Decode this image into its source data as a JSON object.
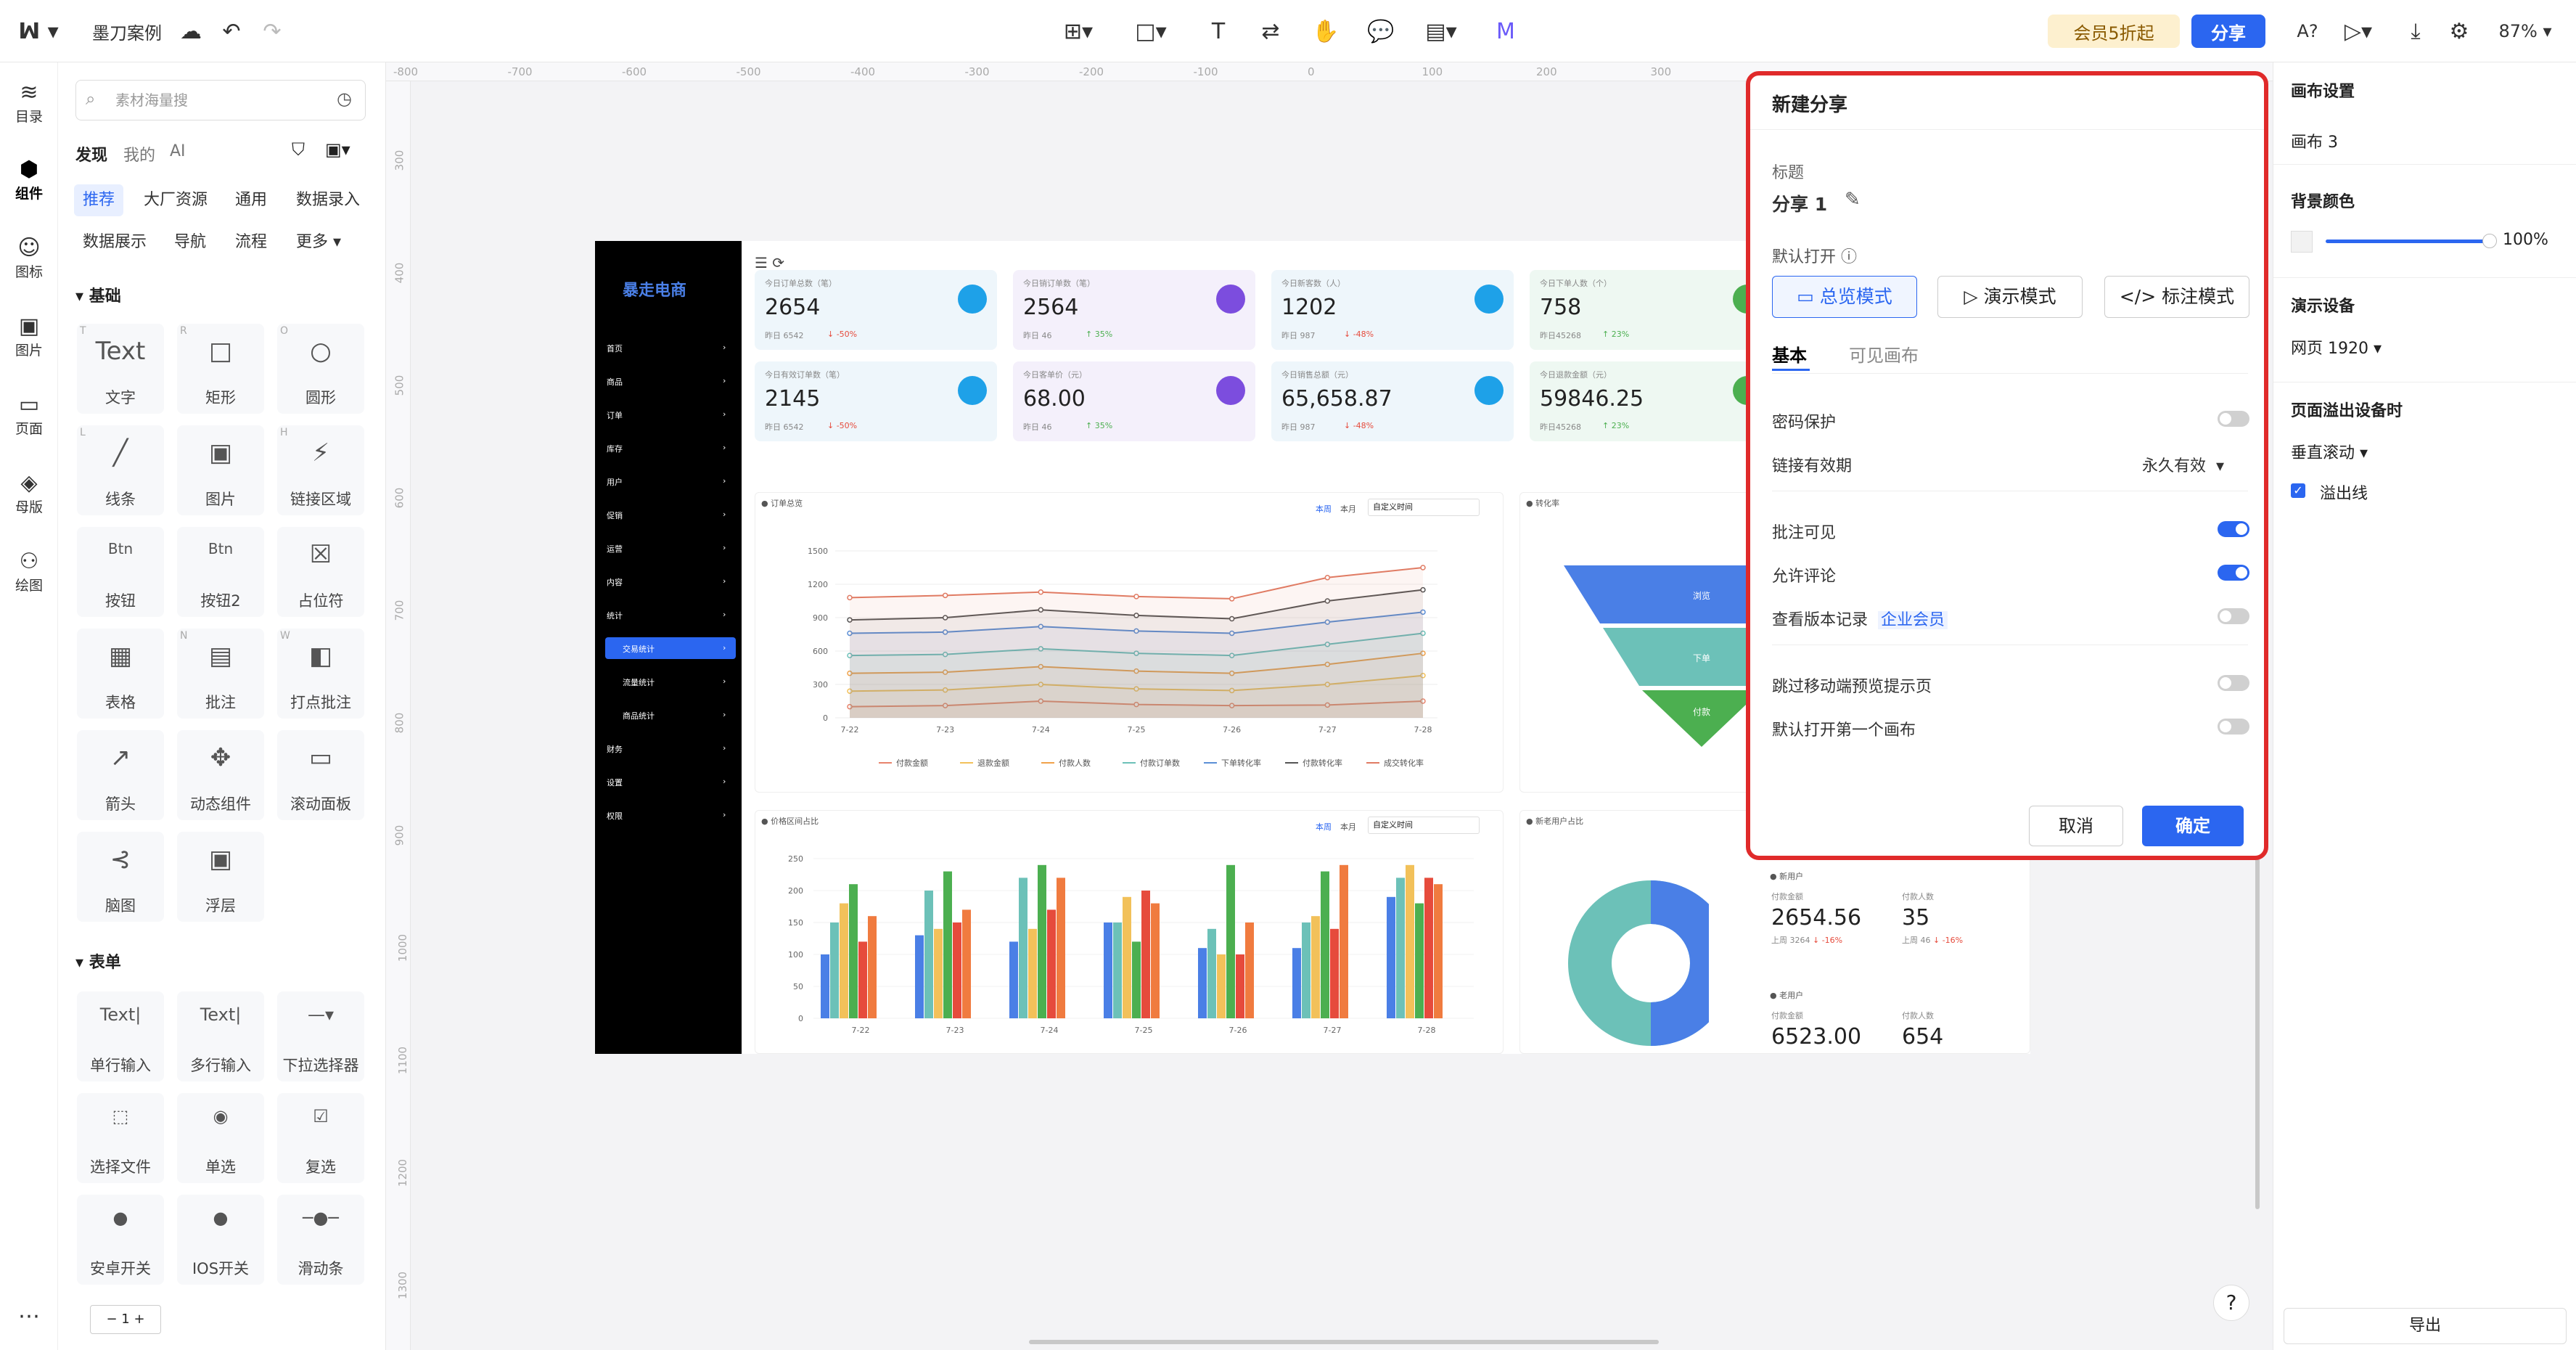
{
  "topbar": {
    "project": "墨刀案例",
    "vip": "会员5折起",
    "share": "分享",
    "zoom": "87%",
    "help": "A?"
  },
  "rail": [
    {
      "label": "目录",
      "icon": "layers-icon"
    },
    {
      "label": "组件",
      "icon": "component-icon"
    },
    {
      "label": "图标",
      "icon": "smile-icon"
    },
    {
      "label": "图片",
      "icon": "image-icon"
    },
    {
      "label": "页面",
      "icon": "page-icon"
    },
    {
      "label": "母版",
      "icon": "master-icon"
    },
    {
      "label": "绘图",
      "icon": "draw-icon"
    }
  ],
  "panel": {
    "search_placeholder": "素材海量搜",
    "tabs": [
      "发现",
      "我的",
      "AI"
    ],
    "chips": [
      "推荐",
      "大厂资源",
      "通用",
      "数据录入",
      "数据展示",
      "导航",
      "流程",
      "更多"
    ],
    "sec_basic": "基础",
    "basic": [
      [
        "Text",
        "文字",
        "T"
      ],
      [
        "□",
        "矩形",
        "R"
      ],
      [
        "○",
        "圆形",
        "O"
      ],
      [
        "╱",
        "线条",
        "L"
      ],
      [
        "▣",
        "图片",
        ""
      ],
      [
        "⚡",
        "链接区域",
        "H"
      ],
      [
        "Btn",
        "按钮",
        ""
      ],
      [
        "Btn",
        "按钮2",
        ""
      ],
      [
        "☒",
        "占位符",
        ""
      ],
      [
        "▦",
        "表格",
        ""
      ],
      [
        "▤",
        "批注",
        "N"
      ],
      [
        "◧",
        "打点批注",
        "W"
      ],
      [
        "↗",
        "箭头",
        ""
      ],
      [
        "✥",
        "动态组件",
        ""
      ],
      [
        "▭",
        "滚动面板",
        ""
      ],
      [
        "⊰",
        "脑图",
        ""
      ],
      [
        "▣",
        "浮层",
        ""
      ]
    ],
    "sec_form": "表单",
    "form": [
      [
        "Text|",
        "单行输入"
      ],
      [
        "Text|",
        "多行输入"
      ],
      [
        "—▾",
        "下拉选择器"
      ],
      [
        "⬚",
        "选择文件"
      ],
      [
        "◉",
        "单选"
      ],
      [
        "☑",
        "复选"
      ],
      [
        "●",
        "安卓开关"
      ],
      [
        "●",
        "IOS开关"
      ],
      [
        "─●─",
        "滑动条"
      ]
    ],
    "stepper": "1"
  },
  "ruler": {
    "x": [
      "-800",
      "-700",
      "-600",
      "-500",
      "-400",
      "-300",
      "-200",
      "-100",
      "0",
      "100",
      "200",
      "300"
    ],
    "y": [
      "300",
      "400",
      "500",
      "600",
      "700",
      "800",
      "900",
      "1000",
      "1100",
      "1200",
      "1300"
    ]
  },
  "artboard": {
    "brand": "暴走电商",
    "menu": [
      "首页",
      "商品",
      "订单",
      "库存",
      "用户",
      "促销",
      "运营",
      "内容",
      "统计",
      "交易统计",
      "流量统计",
      "商品统计",
      "财务",
      "设置",
      "权限"
    ],
    "cards": [
      {
        "t": "今日订单总数（笔）",
        "v": "2654",
        "s": "昨日 6542",
        "d": "↓ -50%"
      },
      {
        "t": "今日销订单数（笔）",
        "v": "2564",
        "s": "昨日 46",
        "d": "↑ 35%"
      },
      {
        "t": "今日新客数（人）",
        "v": "1202",
        "s": "昨日 987",
        "d": "↓ -48%"
      },
      {
        "t": "今日下单人数（个）",
        "v": "758",
        "s": "昨日45268",
        "d": "↑ 23%"
      },
      {
        "t": "今日有效订单数（笔）",
        "v": "2145",
        "s": "昨日 6542",
        "d": "↓ -50%"
      },
      {
        "t": "今日客单价（元）",
        "v": "68.00",
        "s": "昨日 46",
        "d": "↑ 35%"
      },
      {
        "t": "今日销售总额（元）",
        "v": "65,658.87",
        "s": "昨日 987",
        "d": "↓ -48%"
      },
      {
        "t": "今日退款金额（元）",
        "v": "59846.25",
        "s": "昨日45268",
        "d": "↑ 23%"
      }
    ],
    "line_title": "订单总览",
    "funnel_title": "转化率",
    "bar_title": "价格区间占比",
    "donut_title": "新老用户占比",
    "week": "本周",
    "month": "本月",
    "custom": "自定义时间",
    "funnel": [
      "浏览",
      "下单",
      "付款"
    ],
    "new_user": {
      "label": "新用户",
      "amt_l": "付款金额",
      "amt": "2654.56",
      "cnt_l": "付款人数",
      "cnt": "35",
      "s1": "上周 3264",
      "d1": "↓ -16%",
      "s2": "上周 46",
      "d2": "↓ -16%"
    },
    "old_user": {
      "label": "老用户",
      "amt_l": "付款金额",
      "amt": "6523.00",
      "cnt_l": "付款人数",
      "cnt": "654"
    }
  },
  "chart_data": [
    {
      "type": "line",
      "title": "订单总览",
      "categories": [
        "7-22",
        "7-23",
        "7-24",
        "7-25",
        "7-26",
        "7-27",
        "7-28"
      ],
      "ylim": [
        0,
        1500
      ],
      "yticks": [
        "1500",
        "1200",
        "900",
        "600",
        "300",
        "0"
      ],
      "series": [
        {
          "name": "付款金额",
          "color": "#e8836c",
          "values": [
            100,
            110,
            150,
            120,
            110,
            115,
            150
          ]
        },
        {
          "name": "退款金额",
          "color": "#f2c15a",
          "values": [
            240,
            250,
            300,
            260,
            245,
            300,
            380
          ]
        },
        {
          "name": "付款人数",
          "color": "#f0a24a",
          "values": [
            400,
            410,
            460,
            420,
            400,
            480,
            580
          ]
        },
        {
          "name": "付款订单数",
          "color": "#6cc1b8",
          "values": [
            560,
            570,
            620,
            580,
            560,
            660,
            760
          ]
        },
        {
          "name": "下单转化率",
          "color": "#5b8fd6",
          "values": [
            760,
            770,
            820,
            780,
            760,
            860,
            950
          ]
        },
        {
          "name": "付款转化率",
          "color": "#555555",
          "values": [
            880,
            900,
            970,
            920,
            890,
            1050,
            1150
          ]
        },
        {
          "name": "成交转化率",
          "color": "#e07b63",
          "values": [
            1080,
            1100,
            1130,
            1090,
            1070,
            1260,
            1350
          ]
        }
      ]
    },
    {
      "type": "bar",
      "title": "价格区间占比",
      "categories": [
        "7-22",
        "7-23",
        "7-24",
        "7-25",
        "7-26",
        "7-27",
        "7-28"
      ],
      "ylim": [
        0,
        250
      ],
      "yticks": [
        "250",
        "200",
        "150",
        "100",
        "50",
        "0"
      ],
      "colors": [
        "#4a7fe6",
        "#6cc1b8",
        "#f2c15a",
        "#4caf50",
        "#e64b3c",
        "#f07b3f"
      ],
      "groups": [
        [
          100,
          150,
          180,
          210,
          120,
          160
        ],
        [
          130,
          200,
          140,
          230,
          150,
          170
        ],
        [
          120,
          220,
          140,
          240,
          170,
          220
        ],
        [
          150,
          150,
          190,
          120,
          200,
          180
        ],
        [
          110,
          140,
          100,
          240,
          100,
          150
        ],
        [
          110,
          150,
          160,
          230,
          140,
          240
        ],
        [
          190,
          220,
          240,
          180,
          220,
          210
        ]
      ]
    },
    {
      "type": "pie",
      "title": "新老用户占比",
      "values": [
        50,
        50
      ],
      "colors": [
        "#4a7fe6",
        "#6cc1b8"
      ]
    }
  ],
  "modal": {
    "title": "新建分享",
    "label_title": "标题",
    "share_name": "分享 1",
    "default_open": "默认打开",
    "modes": [
      "总览模式",
      "演示模式",
      "标注模式"
    ],
    "tabs": [
      "基本",
      "可见画布"
    ],
    "rows": [
      {
        "label": "密码保护",
        "on": false
      },
      {
        "label": "链接有效期",
        "value": "永久有效"
      },
      {
        "label": "批注可见",
        "on": true
      },
      {
        "label": "允许评论",
        "on": true
      },
      {
        "label": "查看版本记录",
        "tag": "企业会员",
        "on": false
      },
      {
        "label": "跳过移动端预览提示页",
        "on": false
      },
      {
        "label": "默认打开第一个画布",
        "on": false
      }
    ],
    "cancel": "取消",
    "ok": "确定"
  },
  "right": {
    "canvas_set": "画布设置",
    "canvas_name": "画布 3",
    "bg": "背景颜色",
    "opacity": "100%",
    "device": "演示设备",
    "device_val": "网页 1920",
    "overflow": "页面溢出设备时",
    "overflow_val": "垂直滚动",
    "overflow_line": "溢出线",
    "export": "导出"
  }
}
